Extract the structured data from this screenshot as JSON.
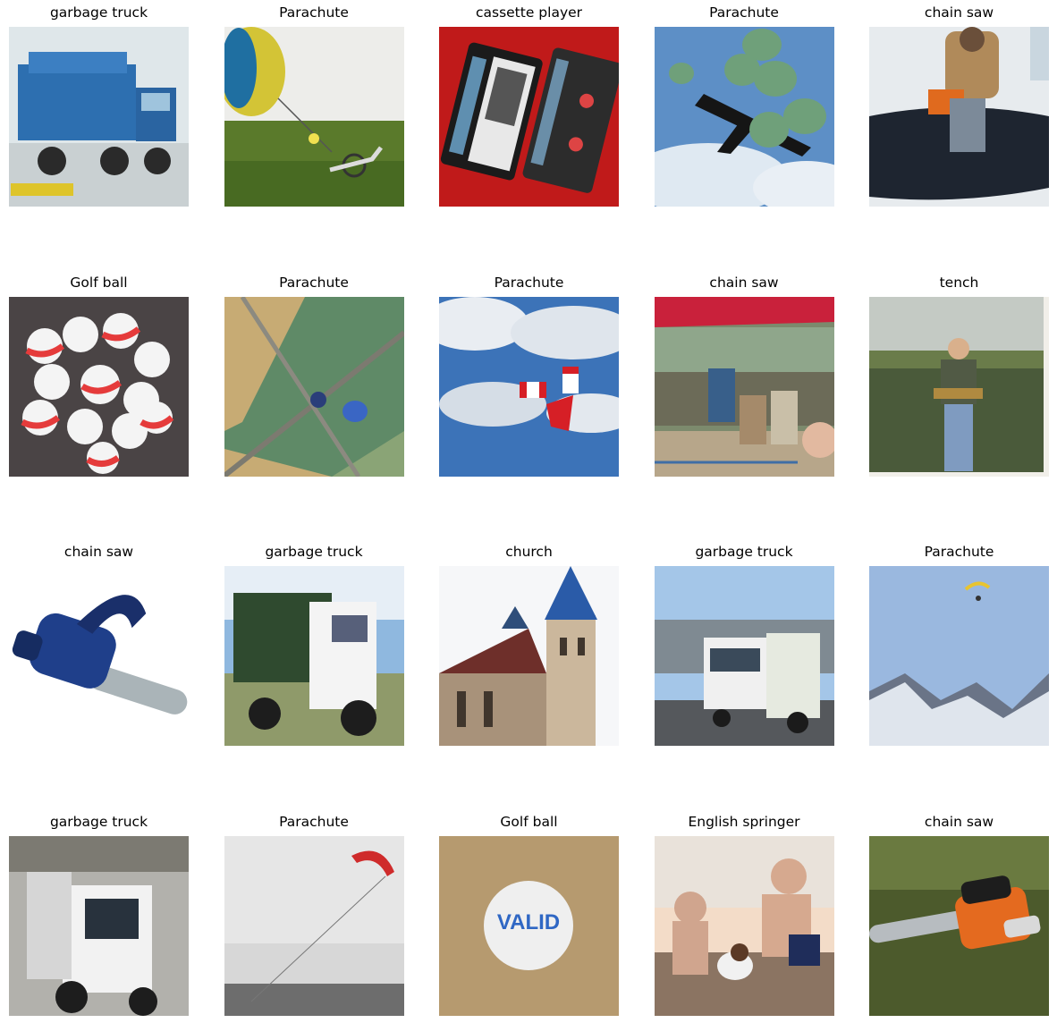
{
  "figure": {
    "images": [
      {
        "label": "garbage truck",
        "icon": "garbage-truck"
      },
      {
        "label": "Parachute",
        "icon": "paraglider-ground"
      },
      {
        "label": "cassette player",
        "icon": "cassette"
      },
      {
        "label": "Parachute",
        "icon": "parachute-drop"
      },
      {
        "label": "chain saw",
        "icon": "ice-saw"
      },
      {
        "label": "Golf ball",
        "icon": "golf-balls-pile"
      },
      {
        "label": "Parachute",
        "icon": "skydiver-aerial"
      },
      {
        "label": "Parachute",
        "icon": "canadian-flags-sky"
      },
      {
        "label": "chain saw",
        "icon": "carving-tent"
      },
      {
        "label": "tench",
        "icon": "man-fish"
      },
      {
        "label": "chain saw",
        "icon": "blue-chainsaw"
      },
      {
        "label": "garbage truck",
        "icon": "green-truck"
      },
      {
        "label": "church",
        "icon": "church"
      },
      {
        "label": "garbage truck",
        "icon": "white-truck"
      },
      {
        "label": "Parachute",
        "icon": "paraglider-mountains"
      },
      {
        "label": "garbage truck",
        "icon": "truck-garage"
      },
      {
        "label": "Parachute",
        "icon": "kite-sea"
      },
      {
        "label": "Golf ball",
        "icon": "valid-ball"
      },
      {
        "label": "English springer",
        "icon": "kids-dog"
      },
      {
        "label": "chain saw",
        "icon": "orange-chainsaw"
      }
    ],
    "text": {
      "valid_ball": "VALID"
    }
  }
}
